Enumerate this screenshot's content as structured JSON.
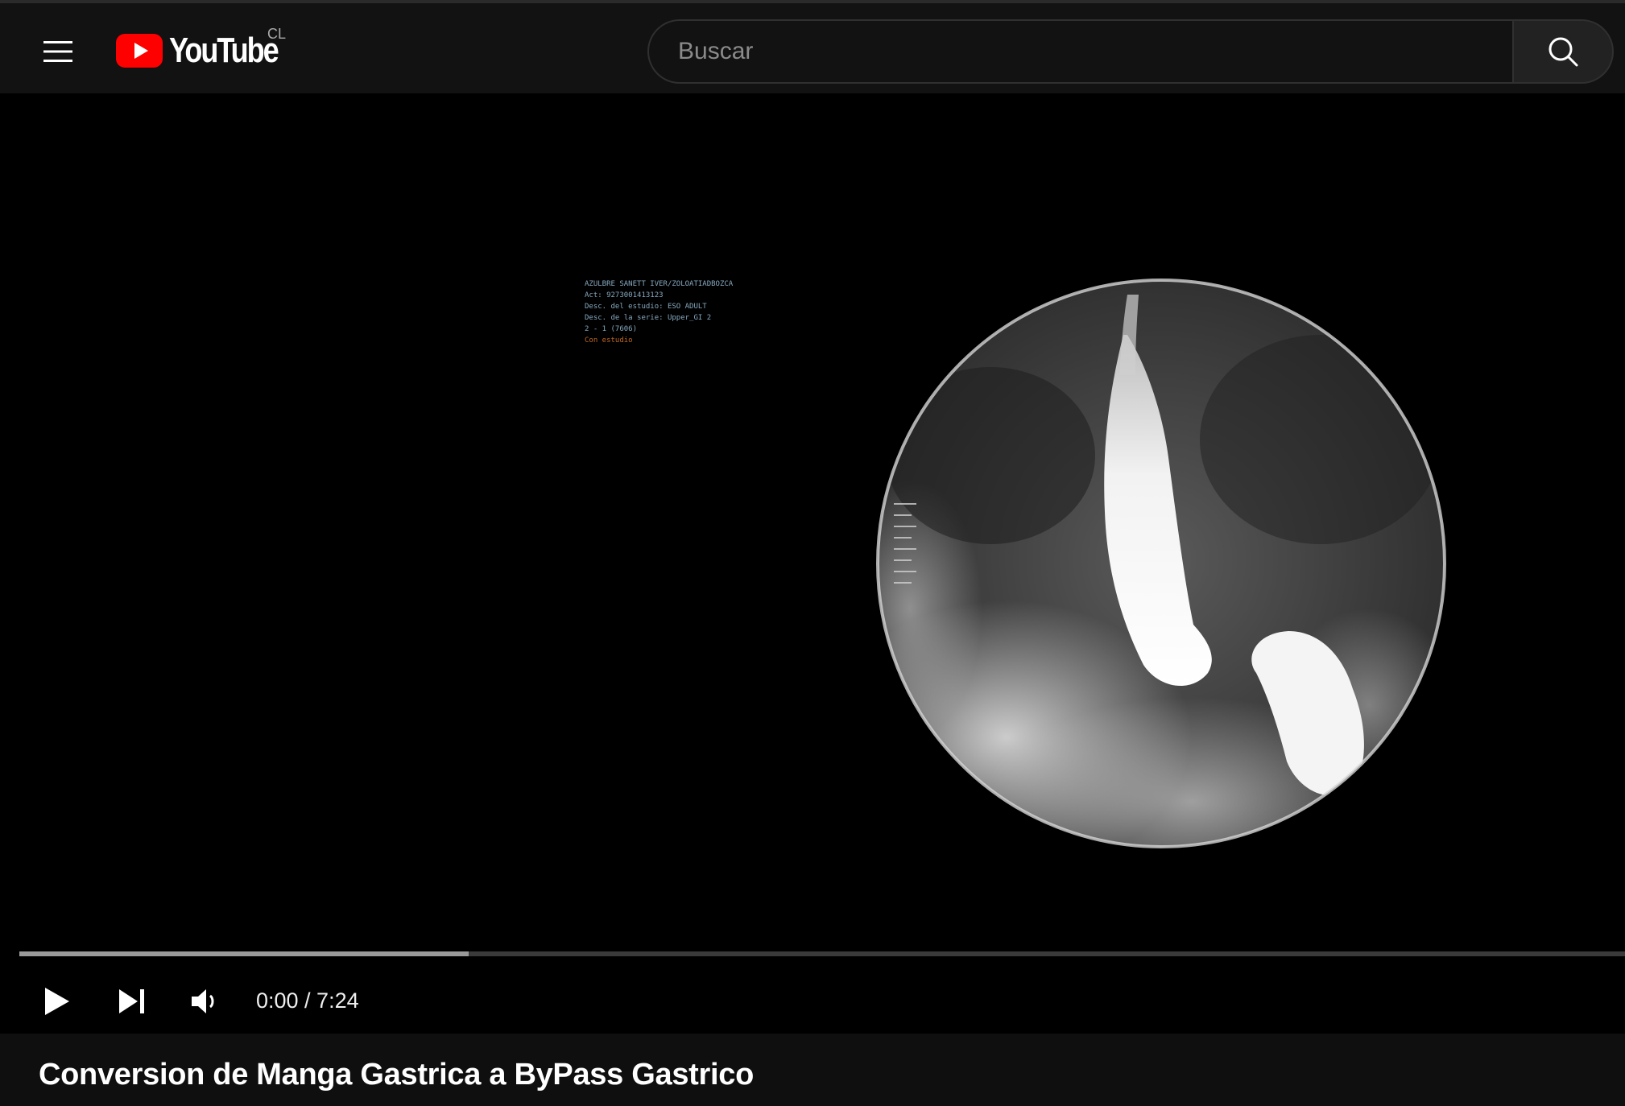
{
  "header": {
    "logo_text": "YouTube",
    "country_code": "CL",
    "search_placeholder": "Buscar",
    "icons": {
      "menu": "hamburger-menu-icon",
      "logo": "youtube-play-icon",
      "search": "search-icon"
    },
    "brand_color": "#ff0000"
  },
  "player": {
    "overlay_lines": [
      "AZULBRE SANETT IVER/ZOLOATIADBOZCA",
      "Act: 9273001413123",
      "Desc. del estudio: ESO ADULT",
      "Desc. de la serie: Upper_GI 2",
      "2 - 1 (7606)",
      "Con estudio"
    ],
    "time_display": "0:00 / 7:24",
    "buffered_fraction": 0.28,
    "icons": {
      "play": "play-icon",
      "next": "skip-next-icon",
      "volume": "volume-icon"
    }
  },
  "video": {
    "title": "Conversion de Manga Gastrica a ByPass Gastrico"
  }
}
